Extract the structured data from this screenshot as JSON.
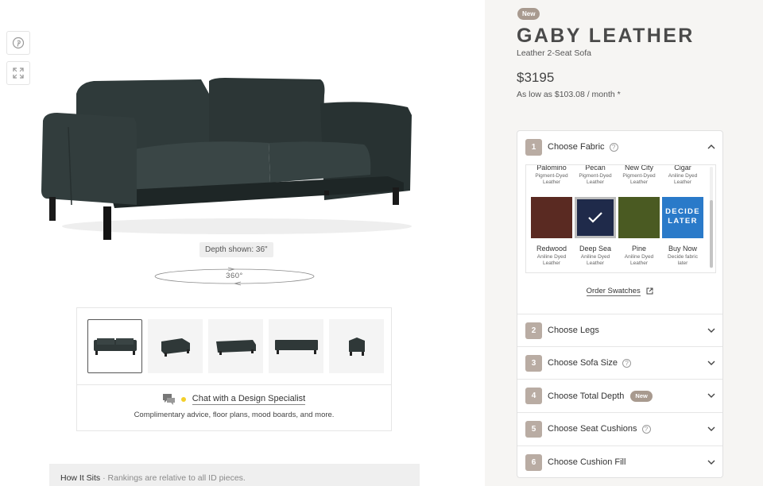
{
  "depth_shown": "Depth shown: 36\"",
  "rotate_label": "360°",
  "chat": {
    "link": "Chat with a Design Specialist",
    "subtitle": "Complimentary advice, floor plans, mood boards, and more."
  },
  "how_it_sits": {
    "title": "How It Sits",
    "note": " · Rankings are relative to all ID pieces."
  },
  "product": {
    "badge": "New",
    "title": "GABY LEATHER",
    "subtitle": "Leather 2-Seat Sofa",
    "price": "$3195",
    "finance": "As low as $103.08 / month *"
  },
  "steps": [
    {
      "num": "1",
      "label": "Choose Fabric",
      "help": "?",
      "expanded": true
    },
    {
      "num": "2",
      "label": "Choose Legs"
    },
    {
      "num": "3",
      "label": "Choose Sofa Size",
      "help": "?"
    },
    {
      "num": "4",
      "label": "Choose Total Depth",
      "badge": "New"
    },
    {
      "num": "5",
      "label": "Choose Seat Cushions",
      "help": "?"
    },
    {
      "num": "6",
      "label": "Choose Cushion Fill"
    }
  ],
  "fabrics_top": [
    {
      "name": "Palomino",
      "desc1": "Pigment-Dyed",
      "desc2": "Leather"
    },
    {
      "name": "Pecan",
      "desc1": "Pigment-Dyed",
      "desc2": "Leather"
    },
    {
      "name": "New City",
      "desc1": "Pigment-Dyed",
      "desc2": "Leather"
    },
    {
      "name": "Cigar",
      "desc1": "Aniline Dyed",
      "desc2": "Leather"
    }
  ],
  "fabrics": [
    {
      "name": "Redwood",
      "desc1": "Aniline Dyed",
      "desc2": "Leather",
      "color": "#5a2a22"
    },
    {
      "name": "Deep Sea",
      "desc1": "Aniline Dyed",
      "desc2": "Leather",
      "color": "#1f2a4a",
      "selected": true
    },
    {
      "name": "Pine",
      "desc1": "Aniline Dyed",
      "desc2": "Leather",
      "color": "#4a5a22"
    },
    {
      "name": "Buy Now",
      "desc1": "Decide fabric",
      "desc2": "later",
      "color": "#2a7ac9",
      "swatch_text_1": "DECIDE",
      "swatch_text_2": "LATER"
    }
  ],
  "order_swatches": "Order Swatches"
}
